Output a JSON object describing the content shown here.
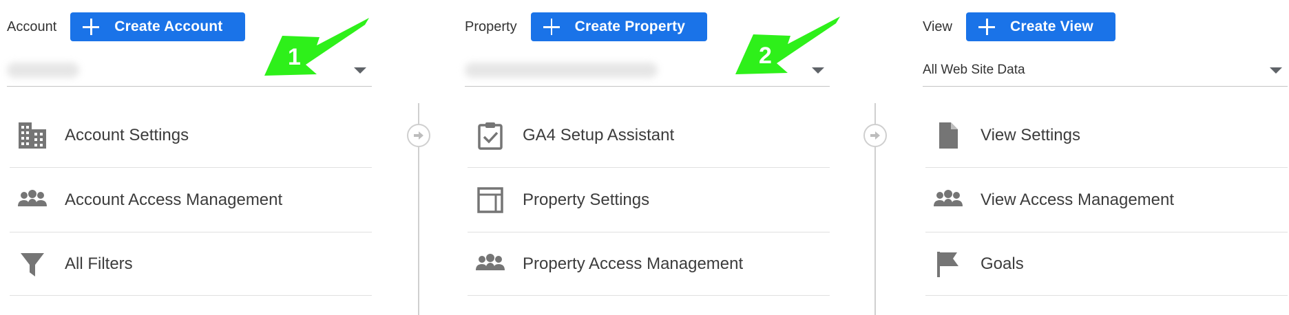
{
  "account": {
    "label": "Account",
    "create_button": "Create Account",
    "menu": [
      {
        "label": "Account Settings",
        "icon": "building-icon"
      },
      {
        "label": "Account Access Management",
        "icon": "people-icon"
      },
      {
        "label": "All Filters",
        "icon": "filter-icon"
      }
    ]
  },
  "property": {
    "label": "Property",
    "create_button": "Create Property",
    "menu": [
      {
        "label": "GA4 Setup Assistant",
        "icon": "clipboard-check-icon"
      },
      {
        "label": "Property Settings",
        "icon": "layout-icon"
      },
      {
        "label": "Property Access Management",
        "icon": "people-icon"
      }
    ]
  },
  "view": {
    "label": "View",
    "create_button": "Create View",
    "selected": "All Web Site Data",
    "menu": [
      {
        "label": "View Settings",
        "icon": "document-icon"
      },
      {
        "label": "View Access Management",
        "icon": "people-icon"
      },
      {
        "label": "Goals",
        "icon": "flag-icon"
      }
    ]
  },
  "annotations": [
    {
      "number": "1",
      "color": "#2ef01a"
    },
    {
      "number": "2",
      "color": "#2ef01a"
    }
  ],
  "colors": {
    "accent": "#1a73e8",
    "icon_gray": "#757575",
    "divider": "#cfcfcf"
  }
}
